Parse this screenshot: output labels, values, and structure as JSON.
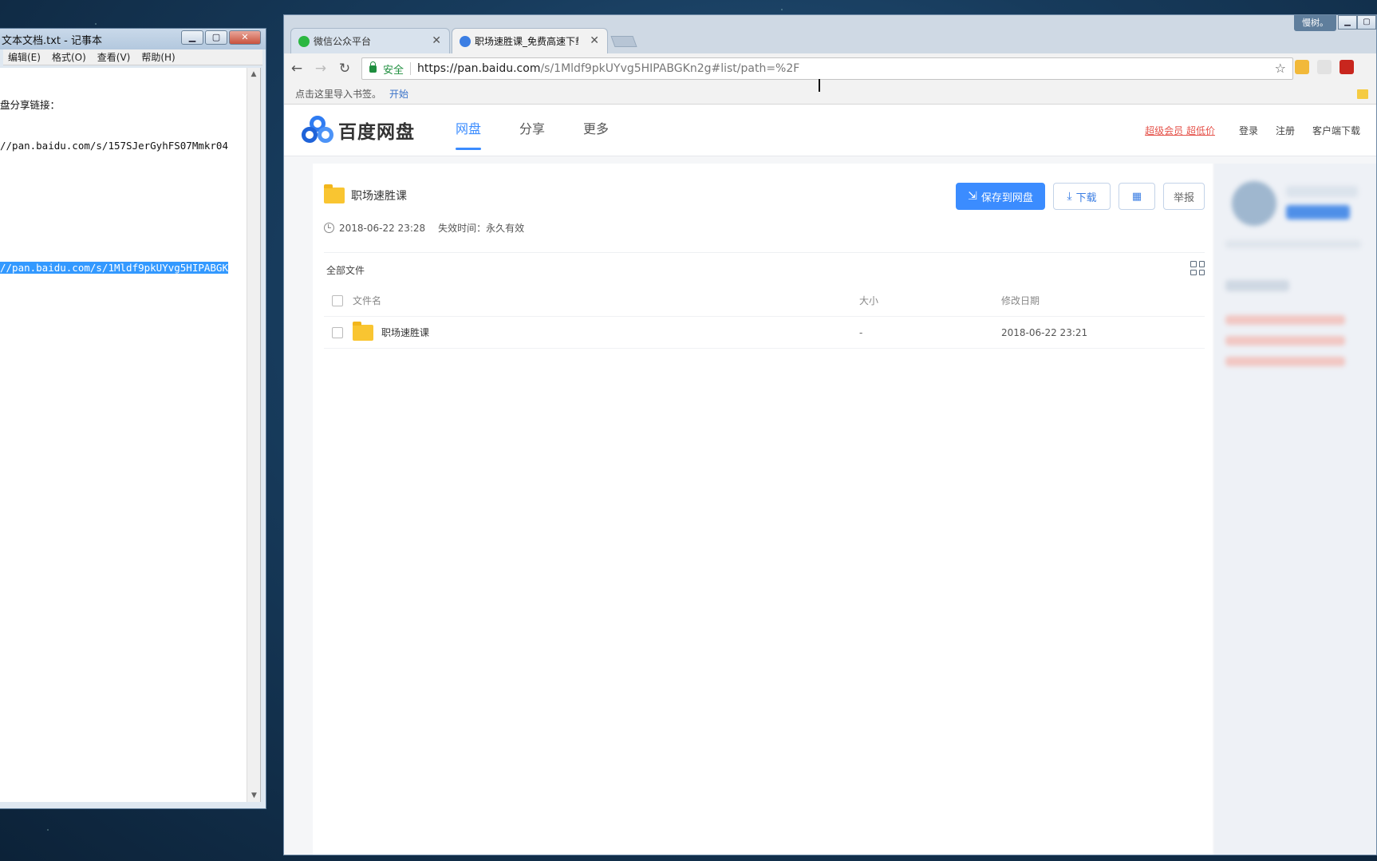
{
  "notepad": {
    "title": "文本文档.txt - 记事本",
    "menu": [
      "编辑(E)",
      "格式(O)",
      "查看(V)",
      "帮助(H)"
    ],
    "lines": [
      "盘分享链接：",
      "//pan.baidu.com/s/157SJerGyhFS07Mmkr04",
      "",
      "",
      "//pan.baidu.com/s/1Mldf9pkUYvg5HIPABGK"
    ],
    "selected_line": "//pan.baidu.com/s/1Mldf9pkUYvg5HIPABGK"
  },
  "browser": {
    "user_badge": "慢树。",
    "tabs": [
      {
        "title": "微信公众平台",
        "active": false,
        "favicon_color": "#2bb741"
      },
      {
        "title": "职场速胜课_免费高速下载",
        "active": true,
        "favicon_color": "#3b7ee3"
      }
    ],
    "address": {
      "secure_label": "安全",
      "url_host": "https://pan.baidu.com",
      "url_rest": "/s/1Mldf9pkUYvg5HIPABGKn2g#list/path=%2F"
    },
    "bookmarks_bar": {
      "prompt": "点击这里导入书签。",
      "start_link": "开始"
    }
  },
  "site": {
    "logo_text": "百度网盘",
    "nav": [
      "网盘",
      "分享",
      "更多"
    ],
    "active_nav": "网盘",
    "header_links": {
      "vip": "超级会员 超低价",
      "login": "登录",
      "register": "注册",
      "client_download": "客户端下载"
    },
    "share": {
      "title": "职场速胜课",
      "created": "2018-06-22 23:28",
      "expire": "失效时间：永久有效",
      "buttons": {
        "save": "保存到网盘",
        "download": "下载",
        "report": "举报"
      }
    },
    "file_list": {
      "breadcrumb": "全部文件",
      "columns": [
        "文件名",
        "大小",
        "修改日期"
      ],
      "rows": [
        {
          "name": "职场速胜课",
          "size": "-",
          "date": "2018-06-22 23:21"
        }
      ]
    }
  },
  "colors": {
    "accent": "#3b8cff",
    "vip_red": "#e5534b",
    "folder_yellow": "#f9c531",
    "secure_green": "#1e8e3e"
  }
}
